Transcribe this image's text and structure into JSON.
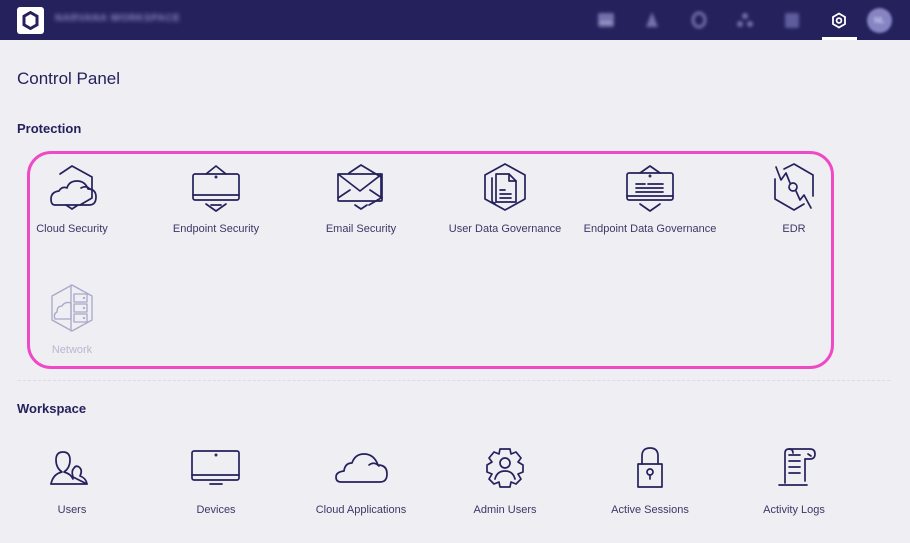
{
  "header": {
    "workspace_name": "NARVANA WORKSPACE",
    "nav_icons": [
      "reports-icon",
      "alerts-icon",
      "notifications-icon",
      "network-map-icon",
      "calendar-icon",
      "settings-icon"
    ],
    "active_nav": "settings-icon",
    "avatar_initials": "NL"
  },
  "page": {
    "title": "Control Panel"
  },
  "sections": {
    "protection": {
      "title": "Protection",
      "items": [
        {
          "label": "Cloud Security",
          "icon": "cloud-security-icon",
          "enabled": true
        },
        {
          "label": "Endpoint Security",
          "icon": "endpoint-security-icon",
          "enabled": true
        },
        {
          "label": "Email Security",
          "icon": "email-security-icon",
          "enabled": true
        },
        {
          "label": "User Data Governance",
          "icon": "user-data-governance-icon",
          "enabled": true
        },
        {
          "label": "Endpoint Data Governance",
          "icon": "endpoint-data-governance-icon",
          "enabled": true
        },
        {
          "label": "EDR",
          "icon": "edr-icon",
          "enabled": true
        },
        {
          "label": "Network",
          "icon": "network-icon",
          "enabled": false
        }
      ]
    },
    "workspace": {
      "title": "Workspace",
      "items": [
        {
          "label": "Users",
          "icon": "users-icon"
        },
        {
          "label": "Devices",
          "icon": "devices-icon"
        },
        {
          "label": "Cloud Applications",
          "icon": "cloud-applications-icon"
        },
        {
          "label": "Admin Users",
          "icon": "admin-users-icon"
        },
        {
          "label": "Active Sessions",
          "icon": "active-sessions-icon"
        },
        {
          "label": "Activity Logs",
          "icon": "activity-logs-icon"
        }
      ]
    }
  },
  "colors": {
    "header_bg": "#25215c",
    "page_bg": "#efeef3",
    "icon_stroke": "#25215c",
    "highlight": "#ef4ac6",
    "disabled": "#a9a8c9"
  }
}
